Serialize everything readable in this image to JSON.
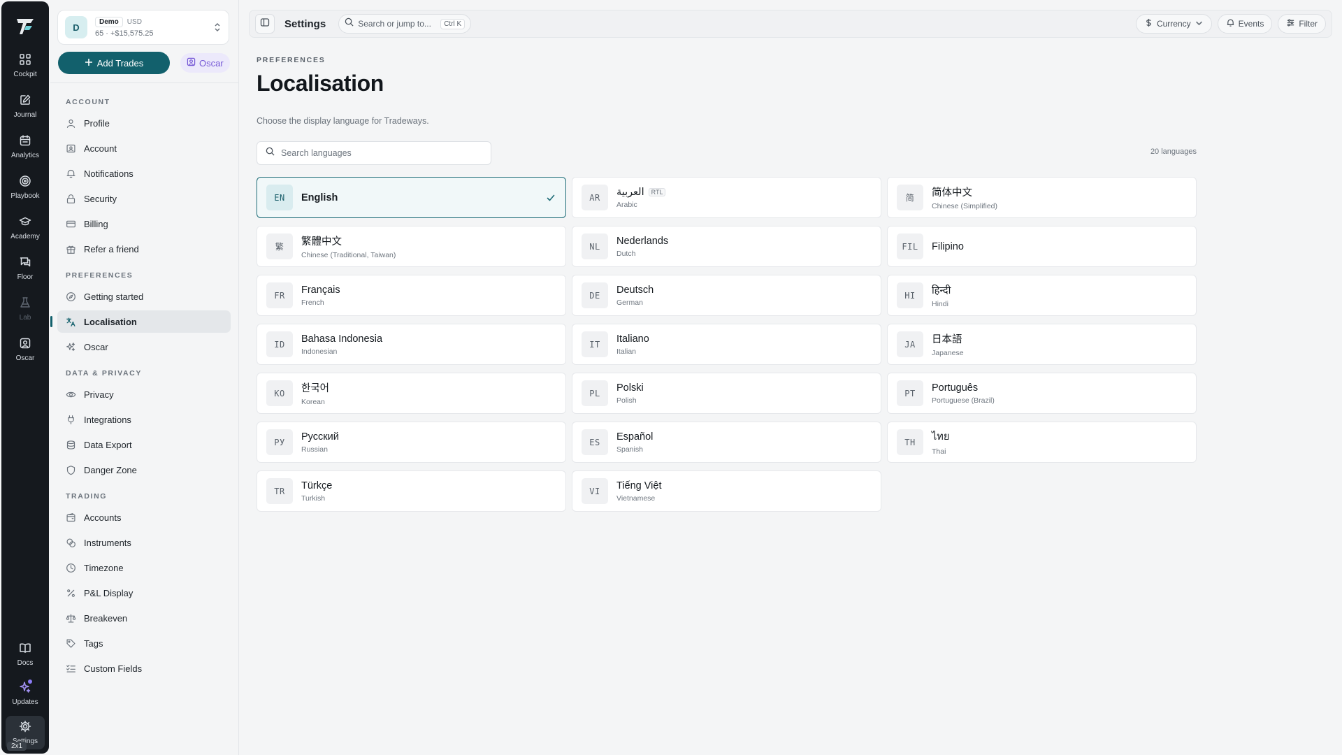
{
  "rail": {
    "items": [
      {
        "label": "Cockpit",
        "icon": "grid-icon"
      },
      {
        "label": "Journal",
        "icon": "journal-icon"
      },
      {
        "label": "Analytics",
        "icon": "calendar-icon"
      },
      {
        "label": "Playbook",
        "icon": "target-icon"
      },
      {
        "label": "Academy",
        "icon": "graduation-cap-icon"
      },
      {
        "label": "Floor",
        "icon": "chat-icon"
      },
      {
        "label": "Lab",
        "icon": "flask-icon"
      },
      {
        "label": "Oscar",
        "icon": "user-square-icon"
      }
    ],
    "bottom": [
      {
        "label": "Docs",
        "icon": "book-icon"
      },
      {
        "label": "Updates",
        "icon": "sparkle-icon"
      },
      {
        "label": "Settings",
        "icon": "gear-icon"
      }
    ],
    "badge": "2x1"
  },
  "account": {
    "avatar": "D",
    "tag": "Demo",
    "currency": "USD",
    "summary": "65 · +$15,575.25"
  },
  "actions": {
    "add_trades": "Add Trades",
    "oscar": "Oscar"
  },
  "nav": {
    "sections": [
      {
        "title": "ACCOUNT",
        "items": [
          {
            "label": "Profile",
            "icon": "user-icon"
          },
          {
            "label": "Account",
            "icon": "id-card-icon"
          },
          {
            "label": "Notifications",
            "icon": "bell-icon"
          },
          {
            "label": "Security",
            "icon": "lock-icon"
          },
          {
            "label": "Billing",
            "icon": "credit-card-icon"
          },
          {
            "label": "Refer a friend",
            "icon": "gift-icon"
          }
        ]
      },
      {
        "title": "PREFERENCES",
        "items": [
          {
            "label": "Getting started",
            "icon": "compass-icon"
          },
          {
            "label": "Localisation",
            "icon": "translate-icon",
            "active": true
          },
          {
            "label": "Oscar",
            "icon": "sparkles-icon"
          }
        ]
      },
      {
        "title": "DATA & PRIVACY",
        "items": [
          {
            "label": "Privacy",
            "icon": "eye-icon"
          },
          {
            "label": "Integrations",
            "icon": "plug-icon"
          },
          {
            "label": "Data Export",
            "icon": "database-icon"
          },
          {
            "label": "Danger Zone",
            "icon": "shield-icon"
          }
        ]
      },
      {
        "title": "TRADING",
        "items": [
          {
            "label": "Accounts",
            "icon": "wallet-icon"
          },
          {
            "label": "Instruments",
            "icon": "coins-icon"
          },
          {
            "label": "Timezone",
            "icon": "clock-icon"
          },
          {
            "label": "P&L Display",
            "icon": "percent-icon"
          },
          {
            "label": "Breakeven",
            "icon": "scale-icon"
          },
          {
            "label": "Tags",
            "icon": "tag-icon"
          },
          {
            "label": "Custom Fields",
            "icon": "list-checks-icon"
          }
        ]
      }
    ]
  },
  "topbar": {
    "title": "Settings",
    "search_placeholder": "Search or jump to...",
    "search_shortcut": "Ctrl K",
    "currency": "Currency",
    "events": "Events",
    "filter": "Filter"
  },
  "main": {
    "eyebrow": "PREFERENCES",
    "title": "Localisation",
    "description": "Choose the display language for Tradeways.",
    "search_placeholder": "Search languages",
    "count": "20 languages",
    "rtl_label": "RTL",
    "languages": [
      {
        "code": "EN",
        "native": "English",
        "english": "",
        "selected": true
      },
      {
        "code": "AR",
        "native": "العربية",
        "english": "Arabic",
        "rtl": true
      },
      {
        "code": "简",
        "native": "简体中文",
        "english": "Chinese (Simplified)"
      },
      {
        "code": "繁",
        "native": "繁體中文",
        "english": "Chinese (Traditional, Taiwan)"
      },
      {
        "code": "NL",
        "native": "Nederlands",
        "english": "Dutch"
      },
      {
        "code": "FIL",
        "native": "Filipino",
        "english": ""
      },
      {
        "code": "FR",
        "native": "Français",
        "english": "French"
      },
      {
        "code": "DE",
        "native": "Deutsch",
        "english": "German"
      },
      {
        "code": "HI",
        "native": "हिन्दी",
        "english": "Hindi"
      },
      {
        "code": "ID",
        "native": "Bahasa Indonesia",
        "english": "Indonesian"
      },
      {
        "code": "IT",
        "native": "Italiano",
        "english": "Italian"
      },
      {
        "code": "JA",
        "native": "日本語",
        "english": "Japanese"
      },
      {
        "code": "KO",
        "native": "한국어",
        "english": "Korean"
      },
      {
        "code": "PL",
        "native": "Polski",
        "english": "Polish"
      },
      {
        "code": "PT",
        "native": "Português",
        "english": "Portuguese (Brazil)"
      },
      {
        "code": "РУ",
        "native": "Русский",
        "english": "Russian"
      },
      {
        "code": "ES",
        "native": "Español",
        "english": "Spanish"
      },
      {
        "code": "TH",
        "native": "ไทย",
        "english": "Thai"
      },
      {
        "code": "TR",
        "native": "Türkçe",
        "english": "Turkish"
      },
      {
        "code": "VI",
        "native": "Tiếng Việt",
        "english": "Vietnamese"
      }
    ]
  },
  "colors": {
    "accent": "#12606c",
    "rail_bg": "#15191e",
    "oscar": "#7659d6"
  }
}
